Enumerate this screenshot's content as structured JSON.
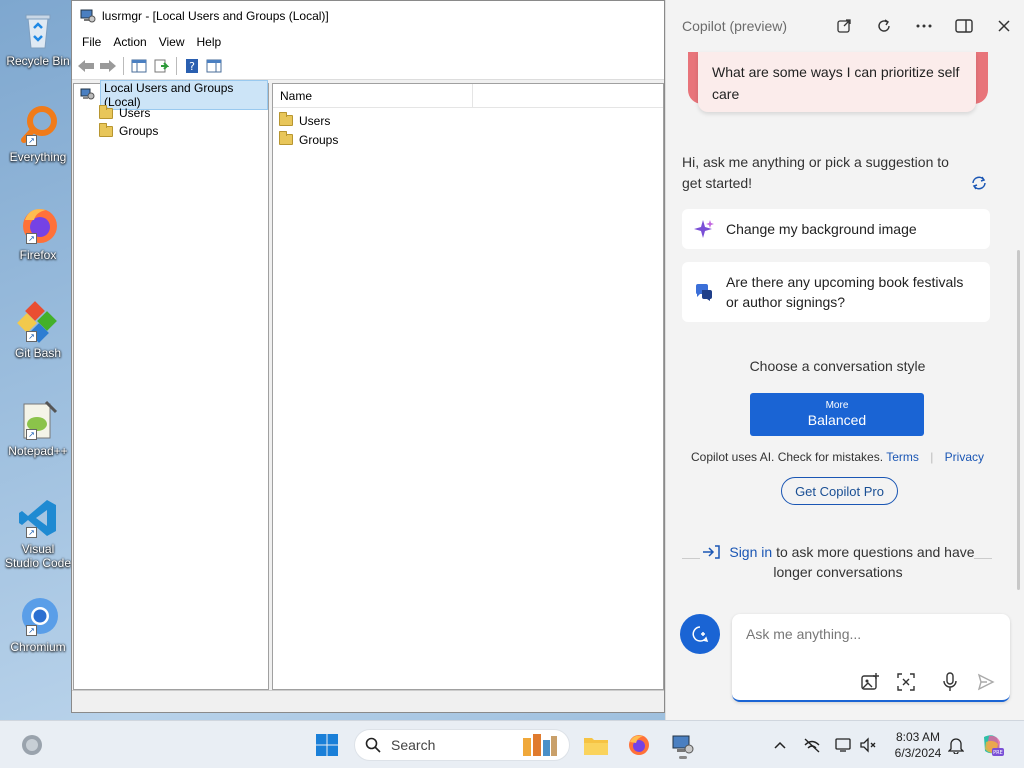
{
  "desktop": {
    "icons": [
      {
        "label": "Recycle Bin"
      },
      {
        "label": "Everything"
      },
      {
        "label": "Firefox"
      },
      {
        "label": "Git Bash"
      },
      {
        "label": "Notepad++"
      },
      {
        "label": "Visual Studio Code"
      },
      {
        "label": "Chromium"
      }
    ]
  },
  "window": {
    "title": "lusrmgr - [Local Users and Groups (Local)]",
    "menu": [
      "File",
      "Action",
      "View",
      "Help"
    ],
    "tree": {
      "root": "Local Users and Groups (Local)",
      "children": [
        "Users",
        "Groups"
      ]
    },
    "list": {
      "column": "Name",
      "rows": [
        "Users",
        "Groups"
      ]
    }
  },
  "copilot": {
    "title": "Copilot (preview)",
    "prompt_card": "What are some ways I can prioritize self care",
    "greeting": "Hi, ask me anything or pick a suggestion to get started!",
    "suggestions": [
      "Change my background image",
      "Are there any upcoming book festivals or author signings?"
    ],
    "style_label": "Choose a conversation style",
    "style_button": {
      "small": "More",
      "main": "Balanced"
    },
    "disclaimer": "Copilot uses AI. Check for mistakes.",
    "terms": "Terms",
    "privacy": "Privacy",
    "pro_button": "Get Copilot Pro",
    "signin_link": "Sign in",
    "signin_rest": "to ask more questions and have longer conversations",
    "input_placeholder": "Ask me anything..."
  },
  "taskbar": {
    "search_label": "Search",
    "time": "8:03 AM",
    "date": "6/3/2024"
  },
  "colors": {
    "accent": "#1a64d4",
    "prompt_card": "#e8747a"
  }
}
